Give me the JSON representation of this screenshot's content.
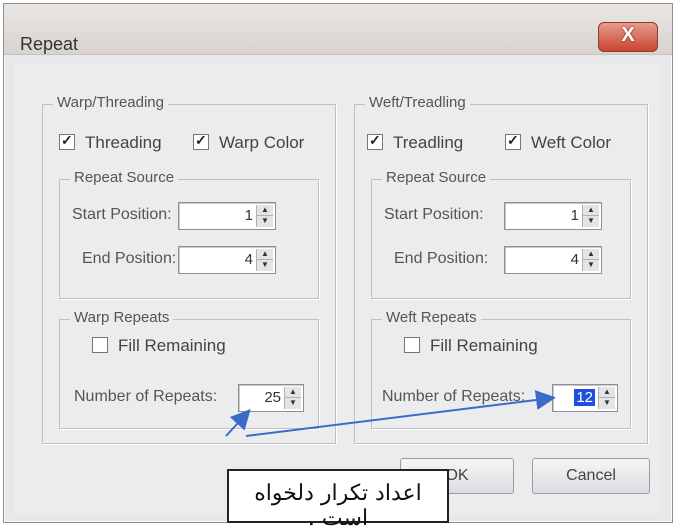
{
  "window": {
    "title": "Repeat",
    "close_label": "X"
  },
  "warp": {
    "group_label": "Warp/Threading",
    "threading_label": "Threading",
    "threading_checked": true,
    "color_label": "Warp Color",
    "color_checked": true,
    "source": {
      "label": "Repeat Source",
      "start_label": "Start Position:",
      "start_value": "1",
      "end_label": "End Position:",
      "end_value": "4"
    },
    "repeats": {
      "label": "Warp Repeats",
      "fill_label": "Fill Remaining",
      "fill_checked": false,
      "number_label": "Number of Repeats:",
      "number_value": "25"
    }
  },
  "weft": {
    "group_label": "Weft/Treadling",
    "treadling_label": "Treadling",
    "treadling_checked": true,
    "color_label": "Weft Color",
    "color_checked": true,
    "source": {
      "label": "Repeat Source",
      "start_label": "Start Position:",
      "start_value": "1",
      "end_label": "End Position:",
      "end_value": "4"
    },
    "repeats": {
      "label": "Weft Repeats",
      "fill_label": "Fill Remaining",
      "fill_checked": false,
      "number_label": "Number of Repeats:",
      "number_value": "12"
    }
  },
  "buttons": {
    "ok": "OK",
    "cancel": "Cancel"
  },
  "annotation": {
    "text": "اعداد تکرار دلخواه است .",
    "arrow_color": "#3a6bc9"
  },
  "colors": {
    "selection": "#1f4fe0",
    "close_button": "#c8452f"
  }
}
